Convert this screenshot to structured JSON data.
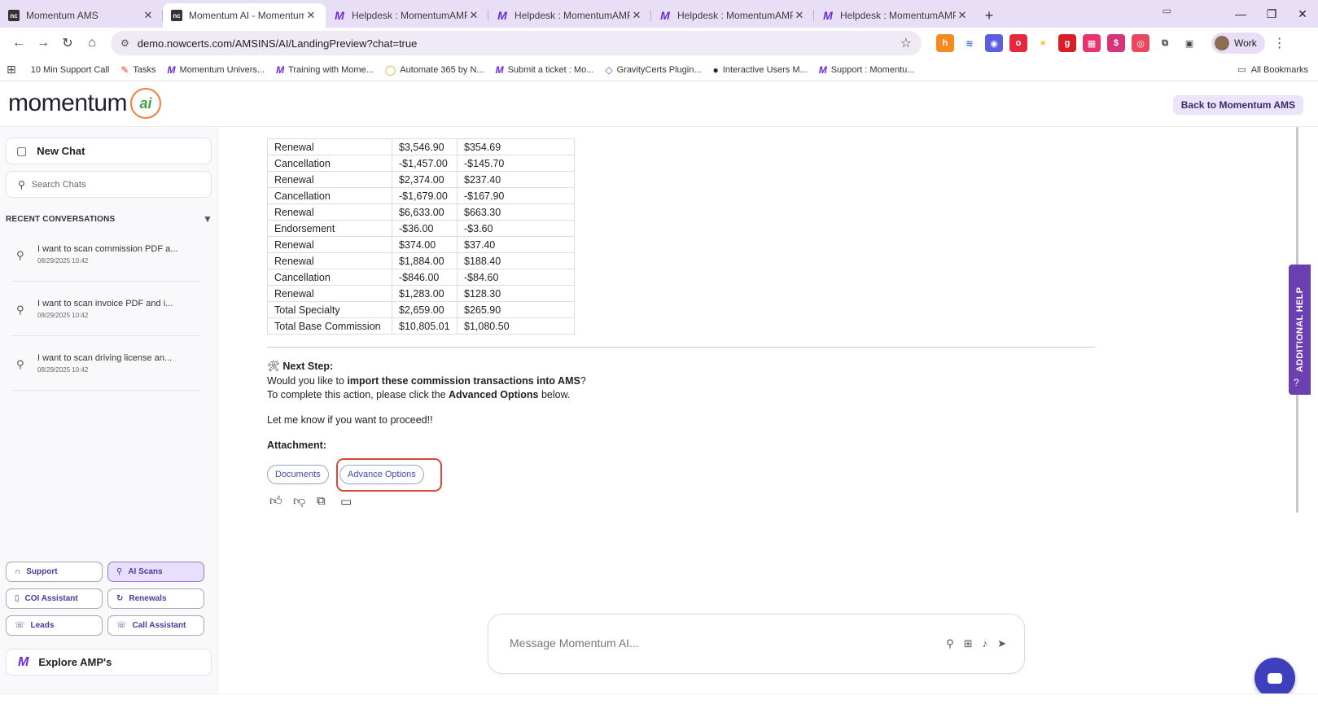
{
  "browser": {
    "tabs": [
      {
        "title": "Momentum AMS",
        "icon": "nc-favicon",
        "active": false
      },
      {
        "title": "Momentum AI - Momentum AMS",
        "icon": "nc-favicon",
        "active": true
      },
      {
        "title": "Helpdesk : MomentumAMP",
        "icon": "momentum-favicon",
        "active": false
      },
      {
        "title": "Helpdesk : MomentumAMP",
        "icon": "momentum-favicon",
        "active": false
      },
      {
        "title": "Helpdesk : MomentumAMP",
        "icon": "momentum-favicon",
        "active": false
      },
      {
        "title": "Helpdesk : MomentumAMP",
        "icon": "momentum-favicon",
        "active": false
      }
    ],
    "url": "demo.nowcerts.com/AMSINS/AI/LandingPreview?chat=true",
    "profile_label": "Work",
    "bookmarks": [
      "10 Min Support Call",
      "Tasks",
      "Momentum Univers...",
      "Training with Mome...",
      "Automate 365 by N...",
      "Submit a ticket : Mo...",
      "GravityCerts Plugin...",
      "Interactive Users M...",
      "Support : Momentu..."
    ],
    "all_bookmarks_label": "All Bookmarks"
  },
  "header": {
    "logo_text": "momentum",
    "back_button": "Back to Momentum AMS"
  },
  "sidebar": {
    "new_chat": "New Chat",
    "search_placeholder": "Search Chats",
    "recent_label": "RECENT CONVERSATIONS",
    "conversations": [
      {
        "title": "I want to scan commission PDF a...",
        "date": "08/29/2025 10:42"
      },
      {
        "title": "I want to scan invoice PDF and i...",
        "date": "08/29/2025 10:42"
      },
      {
        "title": "I want to scan driving license an...",
        "date": "08/29/2025 10:42"
      }
    ],
    "tools": {
      "support": "Support",
      "ai_scans": "AI Scans",
      "coi_assistant": "COI Assistant",
      "renewals": "Renewals",
      "leads": "Leads",
      "call_assistant": "Call Assistant"
    },
    "explore": "Explore AMP's"
  },
  "main": {
    "table_rows": [
      [
        "Renewal",
        "$3,546.90",
        "$354.69"
      ],
      [
        "Cancellation",
        "-$1,457.00",
        "-$145.70"
      ],
      [
        "Renewal",
        "$2,374.00",
        "$237.40"
      ],
      [
        "Cancellation",
        "-$1,679.00",
        "-$167.90"
      ],
      [
        "Renewal",
        "$6,633.00",
        "$663.30"
      ],
      [
        "Endorsement",
        "-$36.00",
        "-$3.60"
      ],
      [
        "Renewal",
        "$374.00",
        "$37.40"
      ],
      [
        "Renewal",
        "$1,884.00",
        "$188.40"
      ],
      [
        "Cancellation",
        "-$846.00",
        "-$84.60"
      ],
      [
        "Renewal",
        "$1,283.00",
        "$128.30"
      ],
      [
        "Total Specialty",
        "$2,659.00",
        "$265.90"
      ],
      [
        "Total Base Commission",
        "$10,805.01",
        "$1,080.50"
      ]
    ],
    "next_step_icon": "🛠",
    "next_step_title": "Next Step:",
    "line1_pre": "Would you like to ",
    "line1_bold": "import these commission transactions into AMS",
    "line1_post": "?",
    "line2_pre": "To complete this action, please click the ",
    "line2_bold": "Advanced Options",
    "line2_post": " below.",
    "line3": "Let me know if you want to proceed!!",
    "attachment_label": "Attachment:",
    "documents_button": "Documents",
    "advance_options_button": "Advance Options",
    "composer_placeholder": "Message Momentum AI..."
  },
  "help_tab": "ADDITIONAL HELP",
  "colors": {
    "accent_purple": "#6b3fb0",
    "highlight_red": "#d9473b",
    "pill_blue": "#3d4fb0"
  }
}
